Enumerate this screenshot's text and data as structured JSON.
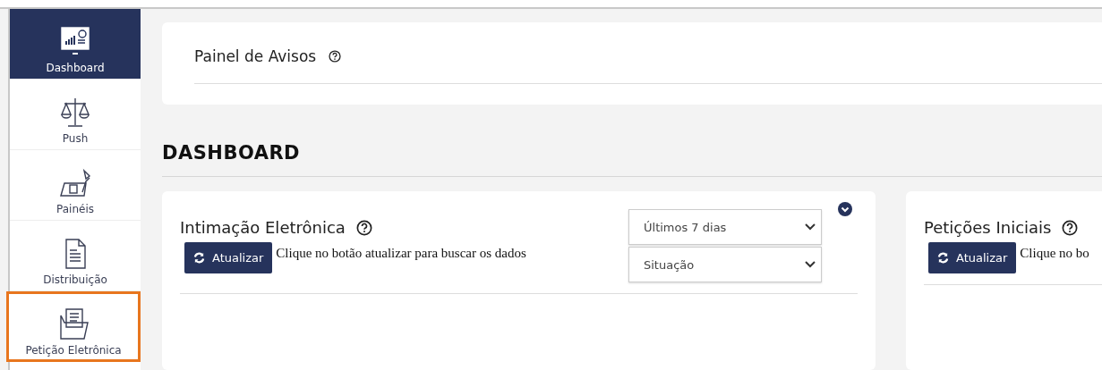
{
  "sidebar": {
    "items": [
      {
        "label": "Dashboard",
        "kind": "dashboard",
        "selected": true,
        "highlighted": false
      },
      {
        "label": "Push",
        "kind": "scale",
        "selected": false,
        "highlighted": false
      },
      {
        "label": "Painéis",
        "kind": "desk",
        "selected": false,
        "highlighted": false
      },
      {
        "label": "Distribuição",
        "kind": "document",
        "selected": false,
        "highlighted": false
      },
      {
        "label": "Petição Eletrônica",
        "kind": "folder",
        "selected": false,
        "highlighted": true
      }
    ]
  },
  "notice_panel": {
    "title": "Painel de Avisos"
  },
  "heading": "DASHBOARD",
  "cards": [
    {
      "title": "Intimação Eletrônica",
      "button": "Atualizar",
      "hint": "Clique no botão atualizar para buscar os dados",
      "selects": [
        "Últimos 7 dias",
        "Situação"
      ],
      "collapse": true
    },
    {
      "title": "Petições Iniciais",
      "button": "Atualizar",
      "hint": "Clique no bo",
      "collapse": false
    }
  ]
}
